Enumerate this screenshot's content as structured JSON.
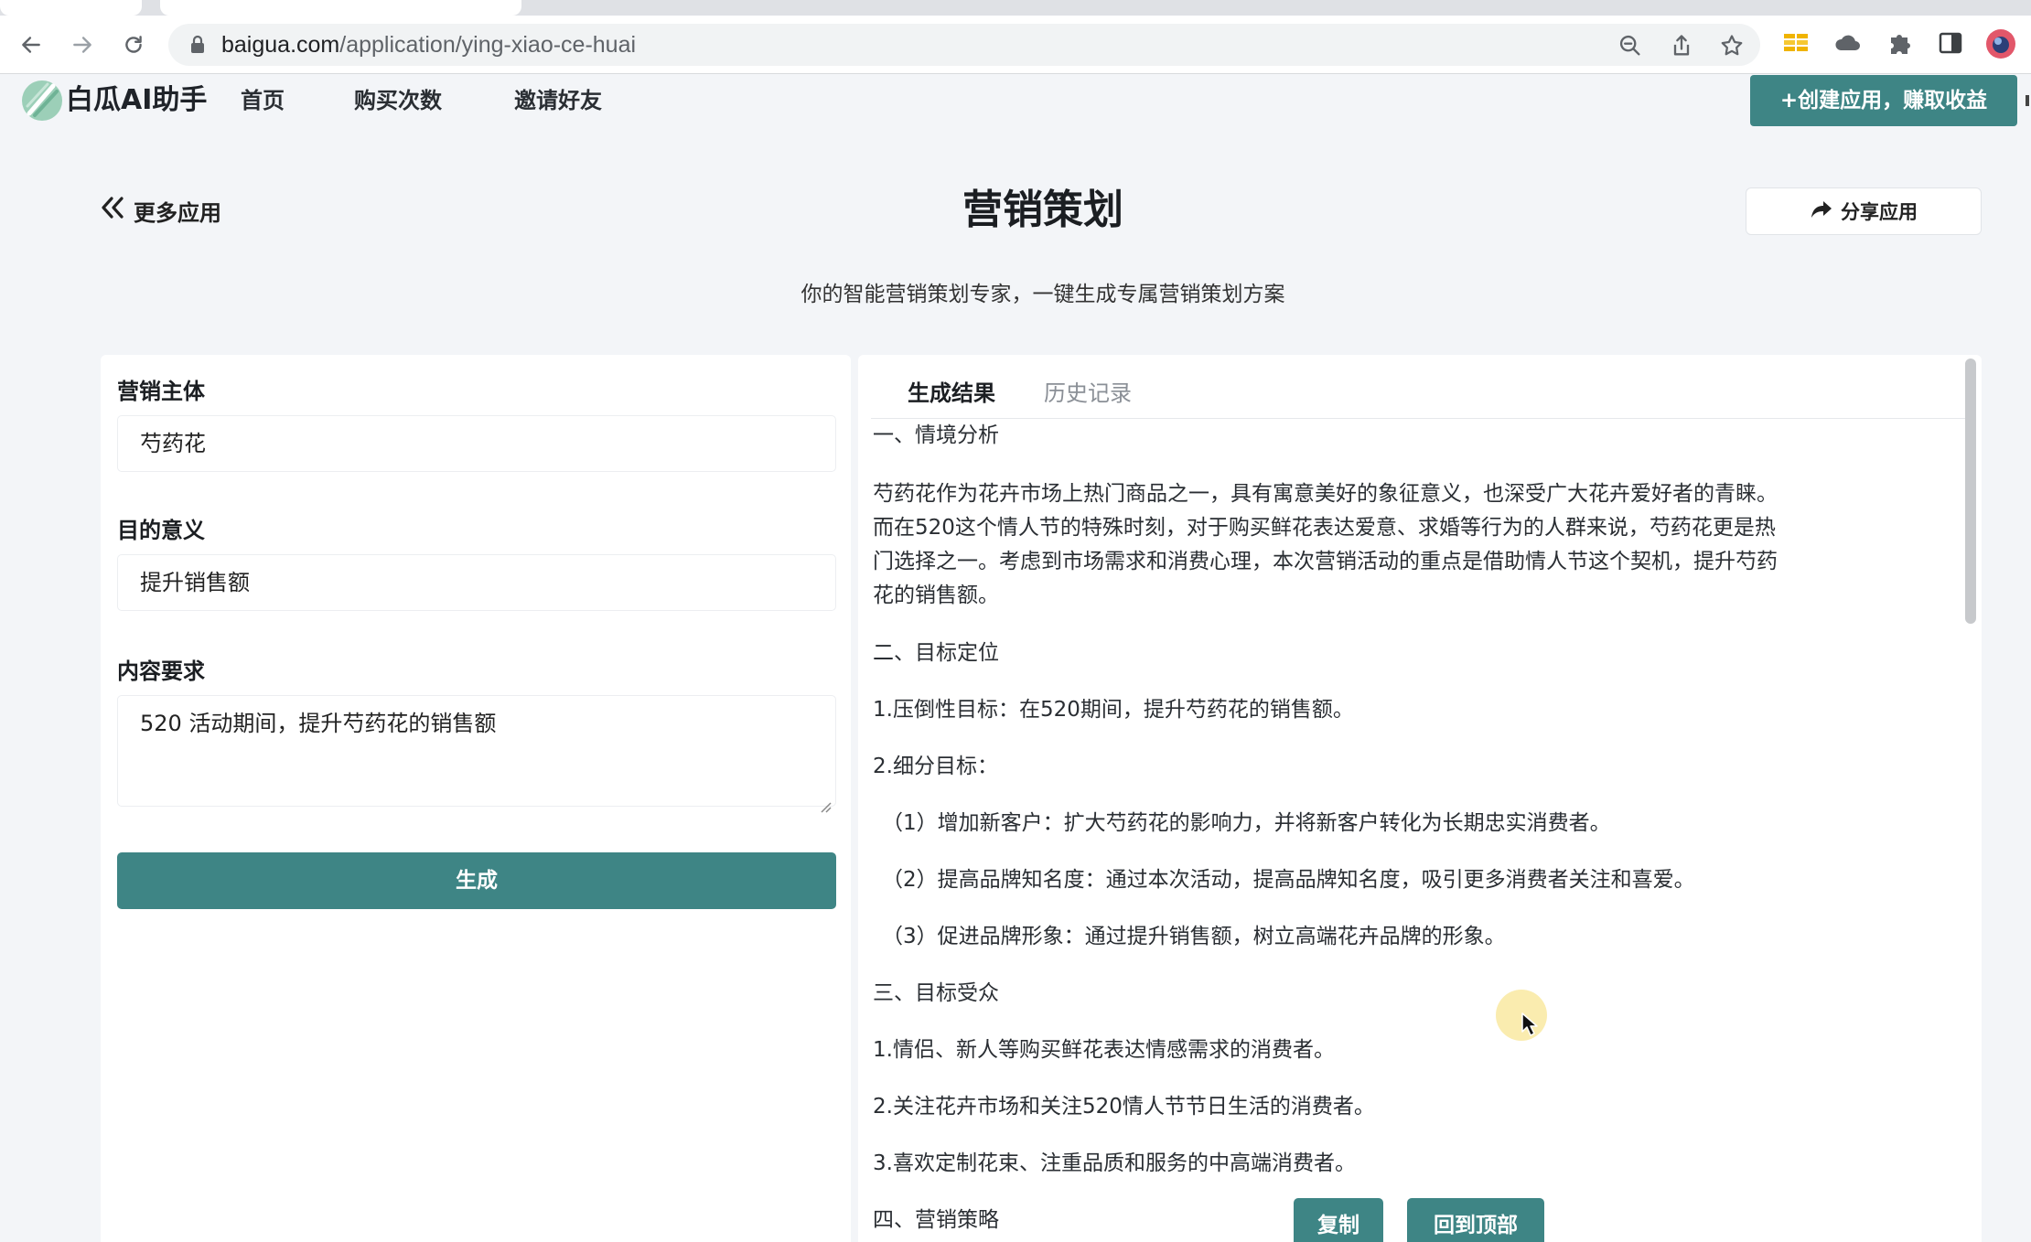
{
  "browser": {
    "url_host": "baigua.com",
    "url_path": "/application/ying-xiao-ce-huai"
  },
  "site": {
    "logo_text": "白瓜AI助手",
    "nav": [
      "首页",
      "购买次数",
      "邀请好友"
    ],
    "create_button": "+创建应用，赚取收益"
  },
  "page": {
    "back_label": "更多应用",
    "title": "营销策划",
    "share_label": "分享应用",
    "subtitle": "你的智能营销策划专家，一键生成专属营销策划方案"
  },
  "form": {
    "fields": [
      {
        "label": "营销主体",
        "value": "芍药花"
      },
      {
        "label": "目的意义",
        "value": "提升销售额"
      },
      {
        "label": "内容要求",
        "value": "520 活动期间，提升芍药花的销售额"
      }
    ],
    "generate_label": "生成"
  },
  "result": {
    "tabs": [
      "生成结果",
      "历史记录"
    ],
    "paragraphs": [
      "一、情境分析",
      "芍药花作为花卉市场上热门商品之一，具有寓意美好的象征意义，也深受广大花卉爱好者的青睐。",
      "而在520这个情人节的特殊时刻，对于购买鲜花表达爱意、求婚等行为的人群来说，芍药花更是热",
      "门选择之一。考虑到市场需求和消费心理，本次营销活动的重点是借助情人节这个契机，提升芍药",
      "花的销售额。",
      "二、目标定位",
      "1.压倒性目标：在520期间，提升芍药花的销售额。",
      "2.细分目标：",
      "（1）增加新客户：扩大芍药花的影响力，并将新客户转化为长期忠实消费者。",
      "（2）提高品牌知名度：通过本次活动，提高品牌知名度，吸引更多消费者关注和喜爱。",
      "（3）促进品牌形象：通过提升销售额，树立高端花卉品牌的形象。",
      "三、目标受众",
      "1.情侣、新人等购买鲜花表达情感需求的消费者。",
      "2.关注花卉市场和关注520情人节节日生活的消费者。",
      "3.喜欢定制花束、注重品质和服务的中高端消费者。",
      "四、营销策略"
    ],
    "copy_label": "复制",
    "top_label": "回到顶部"
  },
  "colors": {
    "accent": "#3e8585",
    "page_bg": "#f3f5f8"
  }
}
